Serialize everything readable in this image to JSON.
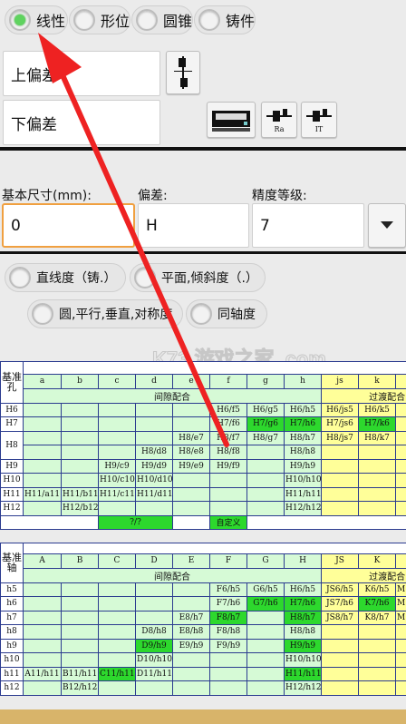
{
  "category_options": [
    {
      "label": "线性",
      "selected": true
    },
    {
      "label": "形位",
      "selected": false
    },
    {
      "label": "圆锥",
      "selected": false
    },
    {
      "label": "铸件",
      "selected": false
    }
  ],
  "upper_deviation": {
    "label": "上偏差"
  },
  "lower_deviation": {
    "label": "下偏差"
  },
  "tool_buttons": {
    "ra_label": "Ra",
    "it_label": "IT"
  },
  "inputs": {
    "basic_size_label": "基本尺寸(mm):",
    "basic_size_value": "0",
    "deviation_label": "偏差:",
    "deviation_value": "H",
    "grade_label": "精度等级:",
    "grade_value": "7"
  },
  "shape_options": [
    {
      "label": "直线度（铸.）",
      "selected": false
    },
    {
      "label": "平面,倾斜度（.）",
      "selected": false
    },
    {
      "label": "圆,平行,垂直,对称度",
      "selected": false
    },
    {
      "label": "同轴度",
      "selected": false
    }
  ],
  "hole_table": {
    "title": "基准孔",
    "columns": [
      "a",
      "b",
      "c",
      "d",
      "e",
      "f",
      "g",
      "h",
      "js",
      "k",
      ""
    ],
    "group_clearance": "间隙配合",
    "group_transition": "过渡配合",
    "rows": [
      {
        "label": "H6",
        "cells": [
          "",
          "",
          "",
          "",
          "",
          "H6/f5",
          "H6/g5",
          "H6/h5",
          "H6/js5",
          "H6/k5",
          ""
        ]
      },
      {
        "label": "H7",
        "cells": [
          "",
          "",
          "",
          "",
          "",
          "H7/f6",
          "H7/g6",
          "H7/h6",
          "H7/js6",
          "H7/k6",
          ""
        ]
      },
      {
        "label": "H8",
        "cells": [
          "",
          "",
          "",
          "",
          "H8/e7",
          "H8/f7",
          "H8/g7",
          "H8/h7",
          "H8/js7",
          "H8/k7",
          ""
        ]
      },
      {
        "label": "",
        "cells": [
          "",
          "",
          "",
          "H8/d8",
          "H8/e8",
          "H8/f8",
          "",
          "H8/h8",
          "",
          "",
          ""
        ]
      },
      {
        "label": "H9",
        "cells": [
          "",
          "",
          "H9/c9",
          "H9/d9",
          "H9/e9",
          "H9/f9",
          "",
          "H9/h9",
          "",
          "",
          ""
        ]
      },
      {
        "label": "H10",
        "cells": [
          "",
          "",
          "H10/c10",
          "H10/d10",
          "",
          "",
          "",
          "H10/h10",
          "",
          "",
          ""
        ]
      },
      {
        "label": "H11",
        "cells": [
          "H11/a11",
          "H11/b11",
          "H11/c11",
          "H11/d11",
          "",
          "",
          "",
          "H11/h11",
          "",
          "",
          ""
        ]
      },
      {
        "label": "H12",
        "cells": [
          "",
          "H12/b12",
          "",
          "",
          "",
          "",
          "",
          "H12/h12",
          "",
          "",
          ""
        ]
      }
    ],
    "buttons": {
      "unknown": "?/?",
      "custom": "自定义"
    }
  },
  "shaft_table": {
    "title": "基准轴",
    "columns": [
      "A",
      "B",
      "C",
      "D",
      "E",
      "F",
      "G",
      "H",
      "JS",
      "K",
      ""
    ],
    "group_clearance": "间隙配合",
    "group_transition": "过渡配合",
    "rows": [
      {
        "label": "h5",
        "cells": [
          "",
          "",
          "",
          "",
          "",
          "F6/h5",
          "G6/h5",
          "H6/h5",
          "JS6/h5",
          "K6/h5",
          "M"
        ]
      },
      {
        "label": "h6",
        "cells": [
          "",
          "",
          "",
          "",
          "",
          "F7/h6",
          "G7/h6",
          "H7/h6",
          "JS7/h6",
          "K7/h6",
          "M"
        ]
      },
      {
        "label": "h7",
        "cells": [
          "",
          "",
          "",
          "",
          "E8/h7",
          "F8/h7",
          "",
          "H8/h7",
          "JS8/h7",
          "K8/h7",
          "M"
        ]
      },
      {
        "label": "h8",
        "cells": [
          "",
          "",
          "",
          "D8/h8",
          "E8/h8",
          "F8/h8",
          "",
          "H8/h8",
          "",
          "",
          ""
        ]
      },
      {
        "label": "h9",
        "cells": [
          "",
          "",
          "",
          "D9/h9",
          "E9/h9",
          "F9/h9",
          "",
          "H9/h9",
          "",
          "",
          ""
        ]
      },
      {
        "label": "h10",
        "cells": [
          "",
          "",
          "",
          "D10/h10",
          "",
          "",
          "",
          "H10/h10",
          "",
          "",
          ""
        ]
      },
      {
        "label": "h11",
        "cells": [
          "A11/h11",
          "B11/h11",
          "C11/h11",
          "D11/h11",
          "",
          "",
          "",
          "H11/h11",
          "",
          "",
          ""
        ]
      },
      {
        "label": "h12",
        "cells": [
          "",
          "B12/h12",
          "",
          "",
          "",
          "",
          "",
          "H12/h12",
          "",
          "",
          ""
        ]
      }
    ]
  },
  "colors": {
    "annotation_arrow": "#ee2222",
    "highlight": "#2dd82d",
    "clearance": "#d6fad6",
    "transition": "#ffff99",
    "focus": "#f0a040",
    "table_border": "#2b3b8f"
  },
  "watermark": "K73 游戏之家 .com"
}
